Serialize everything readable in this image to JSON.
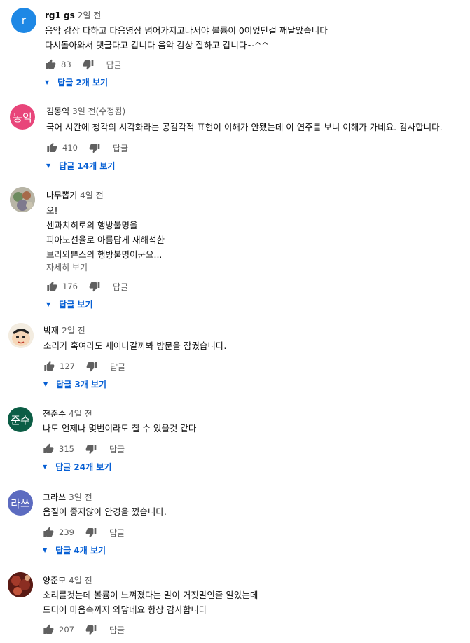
{
  "comments": [
    {
      "avatar_text": "r",
      "avatar_color": "#1e88e5",
      "author": "rg1 gs",
      "time": "2일 전",
      "lines": [
        "음악 감상 다하고 다음영상 넘어가지고나서야 볼륨이 0이었단걸 깨달았습니다",
        "다시돌아와서 댓글다고 갑니다 음악 감상 잘하고 갑니다~^^"
      ],
      "likes": "83",
      "reply_label": "답글",
      "replies_label": "답글 2개 보기"
    },
    {
      "avatar_text": "동익",
      "avatar_color": "#e8457a",
      "author": "김동익",
      "time": "3일 전(수정됨)",
      "lines": [
        "국어 시간에 청각의 시각화라는 공감각적 표현이 이해가 안됐는데 이 연주를 보니 이해가 가네요. 감사합니다."
      ],
      "likes": "410",
      "reply_label": "답글",
      "replies_label": "답글 14개 보기"
    },
    {
      "avatar_text": "",
      "avatar_color": "#9aa08e",
      "author": "나무뽑기",
      "time": "4일 전",
      "lines": [
        "오!",
        "센과치히로의 행방불명을",
        "피아노선율로 아름답게 재해석한",
        "브라와쁜스의 행방불명이군요..."
      ],
      "more_label": "자세히 보기",
      "likes": "176",
      "reply_label": "답글",
      "replies_label": "답글 보기"
    },
    {
      "avatar_text": "",
      "avatar_color": "#f3ece0",
      "author": "박재",
      "time": "2일 전",
      "lines": [
        "소리가 혹여라도 새어나갈까봐 방문을 잠궜습니다."
      ],
      "likes": "127",
      "reply_label": "답글",
      "replies_label": "답글 3개 보기"
    },
    {
      "avatar_text": "준수",
      "avatar_color": "#0b5d45",
      "author": "전준수",
      "time": "4일 전",
      "lines": [
        "나도 언제나 몇번이라도 칠 수 있을것 같다"
      ],
      "likes": "315",
      "reply_label": "답글",
      "replies_label": "답글 24개 보기"
    },
    {
      "avatar_text": "라쓰",
      "avatar_color": "#5c6bc0",
      "author": "그라쓰",
      "time": "3일 전",
      "lines": [
        "음질이 좋지않아 안경을 꼈습니다."
      ],
      "likes": "239",
      "reply_label": "답글",
      "replies_label": "답글 4개 보기"
    },
    {
      "avatar_text": "",
      "avatar_color": "#7a2a22",
      "author": "양준모",
      "time": "4일 전",
      "lines": [
        "소리를것는데 볼륨이 느껴졌다는 말이 거짓말인줄 알았는데",
        "드디어 마음속까지 와닿네요 항상 감사합니다"
      ],
      "likes": "207",
      "reply_label": "답글"
    }
  ]
}
